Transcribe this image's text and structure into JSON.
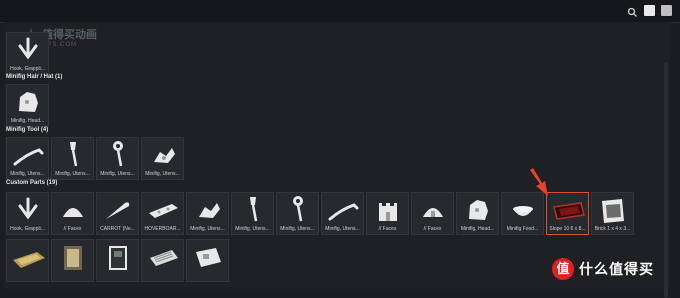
{
  "colors": {
    "accent_arrow": "#e5432b",
    "brand_red": "#e02020",
    "tile_bg": "#26292e"
  },
  "topbar": {
    "icons": [
      "search-icon",
      "white-square-icon",
      "grey-square-icon"
    ]
  },
  "watermark": {
    "title": "值得买动画",
    "sub": "DPS.COM"
  },
  "sections": [
    {
      "title": "",
      "items": [
        {
          "label": "Hook, Grappli...",
          "icon": "grapple-hook"
        }
      ]
    },
    {
      "title": "Minifig Hair / Hat (1)",
      "items": [
        {
          "label": "Minifig, Head...",
          "icon": "minifig-headgear"
        }
      ]
    },
    {
      "title": "Minifig Tool (4)",
      "items": [
        {
          "label": "Minifig, Utens...",
          "icon": "tool-crowbar"
        },
        {
          "label": "Minifig, Utens...",
          "icon": "tool-shovel"
        },
        {
          "label": "Minifig, Utens...",
          "icon": "tool-wrench"
        },
        {
          "label": "Minifig, Utens...",
          "icon": "tool-cluster"
        }
      ]
    },
    {
      "title": "Custom Parts (19)",
      "items": [
        {
          "label": "Hook, Grappli...",
          "icon": "grapple-hook"
        },
        {
          "label": "// Faces",
          "icon": "dome"
        },
        {
          "label": "CARROT (Ne...",
          "icon": "carrot"
        },
        {
          "label": "HOVERBOAR...",
          "icon": "hoverboard"
        },
        {
          "label": "Minifig, Utens...",
          "icon": "tool-cluster"
        },
        {
          "label": "Minifig, Utens...",
          "icon": "tool-shovel"
        },
        {
          "label": "Minifig, Utens...",
          "icon": "tool-wrench"
        },
        {
          "label": "Minifig, Utens...",
          "icon": "tool-crowbar"
        },
        {
          "label": "// Faces",
          "icon": "castle"
        },
        {
          "label": "// Faces",
          "icon": "dome"
        },
        {
          "label": "Minifig, Head...",
          "icon": "minifig-headgear"
        },
        {
          "label": "Minifig Food...",
          "icon": "bowl"
        },
        {
          "label": "Slope 10 6 x 8...",
          "icon": "slope-red"
        },
        {
          "label": "Brick 1 x 4 x 3...",
          "icon": "brick-panel"
        },
        {
          "label": "",
          "icon": "tile-gold"
        },
        {
          "label": "",
          "icon": "tile-ornate"
        },
        {
          "label": "",
          "icon": "tile-dark"
        },
        {
          "label": "",
          "icon": "tile-grille"
        },
        {
          "label": "",
          "icon": "tile-plain"
        }
      ]
    }
  ],
  "brand": {
    "badge": "值",
    "text": "什么值得买"
  }
}
